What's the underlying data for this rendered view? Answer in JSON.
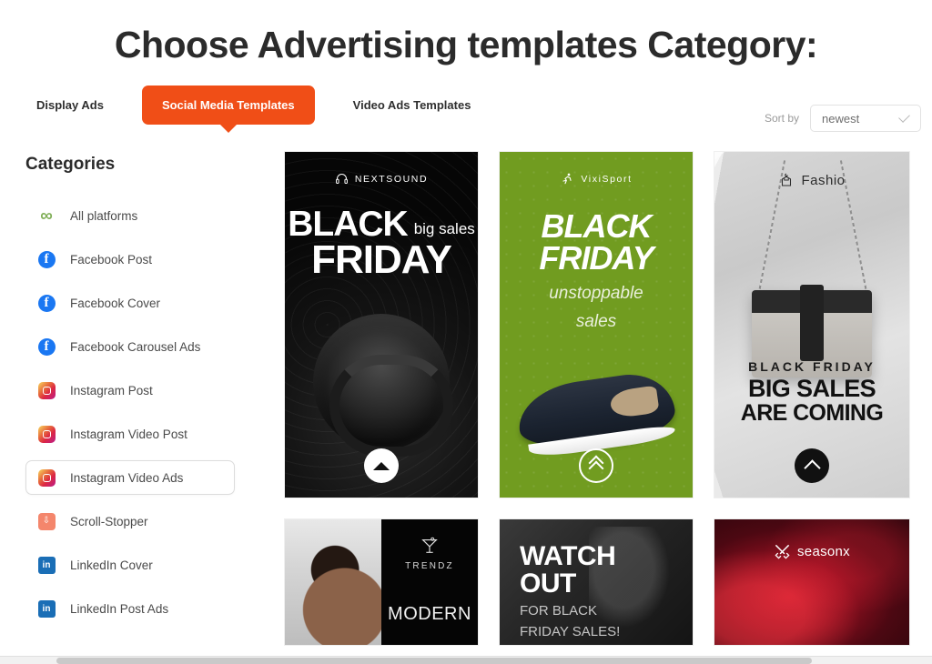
{
  "header": {
    "title": "Choose Advertising templates Category:"
  },
  "tabs": [
    {
      "label": "Display Ads",
      "active": false
    },
    {
      "label": "Social Media Templates",
      "active": true
    },
    {
      "label": "Video Ads Templates",
      "active": false
    }
  ],
  "sort": {
    "label": "Sort by",
    "value": "newest",
    "options": [
      "newest"
    ],
    "chevron_icon": "chevron-down-icon"
  },
  "sidebar": {
    "title": "Categories",
    "items": [
      {
        "label": "All platforms",
        "icon": "infinity-icon",
        "selected": false
      },
      {
        "label": "Facebook Post",
        "icon": "facebook-icon",
        "selected": false
      },
      {
        "label": "Facebook Cover",
        "icon": "facebook-icon",
        "selected": false
      },
      {
        "label": "Facebook Carousel Ads",
        "icon": "facebook-icon",
        "selected": false
      },
      {
        "label": "Instagram Post",
        "icon": "instagram-icon",
        "selected": false
      },
      {
        "label": "Instagram Video Post",
        "icon": "instagram-icon",
        "selected": false
      },
      {
        "label": "Instagram Video Ads",
        "icon": "instagram-icon",
        "selected": true
      },
      {
        "label": "Scroll-Stopper",
        "icon": "double-chevron-down-icon",
        "selected": false
      },
      {
        "label": "LinkedIn Cover",
        "icon": "linkedin-icon",
        "selected": false
      },
      {
        "label": "LinkedIn Post Ads",
        "icon": "linkedin-icon",
        "selected": false
      }
    ]
  },
  "cards": [
    {
      "id": "nextsound-black-friday",
      "brand": "NEXTSOUND",
      "brand_icon": "headphones-icon",
      "headline_big": "BLACK",
      "headline_small": "big sales",
      "headline_line2": "FRIDAY",
      "button_icon": "triangle-up-icon"
    },
    {
      "id": "vixisport-black-friday",
      "brand": "VixiSport",
      "brand_icon": "runner-icon",
      "title_line1": "BLACK",
      "title_line2": "FRIDAY",
      "subtitle_line1": "unstoppable",
      "subtitle_line2": "sales",
      "accent_color": "#719c20",
      "button_icon": "double-chevron-up-icon"
    },
    {
      "id": "fashio-big-sales",
      "brand": "Fashio",
      "brand_icon": "shirt-hanger-icon",
      "eyebrow": "BLACK FRIDAY",
      "title_line1": "BIG SALES",
      "title_line2": "ARE COMING",
      "button_icon": "chevron-up-icon"
    },
    {
      "id": "trendz-modern",
      "brand": "TRENDZ",
      "brand_icon": "cocktail-glass-icon",
      "title": "MODERN"
    },
    {
      "id": "watch-out-black-friday",
      "title_line1": "WATCH",
      "title_line2": "OUT",
      "sub_line1": "FOR BLACK",
      "sub_line2": "FRIDAY SALES!"
    },
    {
      "id": "seasonx",
      "brand": "seasonx",
      "brand_icon": "crossed-swords-icon"
    }
  ],
  "colors": {
    "accent_orange": "#f04e17",
    "green": "#719c20",
    "facebook_blue": "#1a77f2",
    "linkedin_blue": "#1a6eb6",
    "text_dark": "#2b2b2b"
  }
}
